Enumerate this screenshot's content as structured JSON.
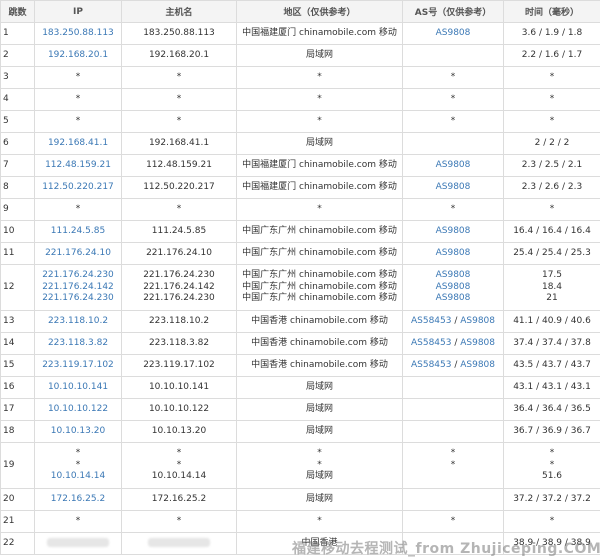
{
  "headers": {
    "hop": "跳数",
    "ip": "IP",
    "host": "主机名",
    "region": "地区（仅供参考）",
    "as": "AS号（仅供参考）",
    "time": "时间（毫秒）"
  },
  "rows": [
    {
      "hop": "1",
      "ip": [
        "183.250.88.113"
      ],
      "host": [
        "183.250.88.113"
      ],
      "region": [
        "中国福建厦门 chinamobile.com 移动"
      ],
      "as": [
        [
          "AS9808"
        ]
      ],
      "time": [
        "3.6 / 1.9 / 1.8"
      ]
    },
    {
      "hop": "2",
      "ip": [
        "192.168.20.1"
      ],
      "host": [
        "192.168.20.1"
      ],
      "region": [
        "局域网"
      ],
      "as": [
        []
      ],
      "time": [
        "2.2 / 1.6 / 1.7"
      ]
    },
    {
      "hop": "3",
      "ip": [
        "*"
      ],
      "host": [
        "*"
      ],
      "region": [
        "*"
      ],
      "as": [
        [
          "*"
        ]
      ],
      "time": [
        "*"
      ]
    },
    {
      "hop": "4",
      "ip": [
        "*"
      ],
      "host": [
        "*"
      ],
      "region": [
        "*"
      ],
      "as": [
        [
          "*"
        ]
      ],
      "time": [
        "*"
      ]
    },
    {
      "hop": "5",
      "ip": [
        "*"
      ],
      "host": [
        "*"
      ],
      "region": [
        "*"
      ],
      "as": [
        [
          "*"
        ]
      ],
      "time": [
        "*"
      ]
    },
    {
      "hop": "6",
      "ip": [
        "192.168.41.1"
      ],
      "host": [
        "192.168.41.1"
      ],
      "region": [
        "局域网"
      ],
      "as": [
        []
      ],
      "time": [
        "2 / 2 / 2"
      ]
    },
    {
      "hop": "7",
      "ip": [
        "112.48.159.21"
      ],
      "host": [
        "112.48.159.21"
      ],
      "region": [
        "中国福建厦门 chinamobile.com 移动"
      ],
      "as": [
        [
          "AS9808"
        ]
      ],
      "time": [
        "2.3 / 2.5 / 2.1"
      ]
    },
    {
      "hop": "8",
      "ip": [
        "112.50.220.217"
      ],
      "host": [
        "112.50.220.217"
      ],
      "region": [
        "中国福建厦门 chinamobile.com 移动"
      ],
      "as": [
        [
          "AS9808"
        ]
      ],
      "time": [
        "2.3 / 2.6 / 2.3"
      ]
    },
    {
      "hop": "9",
      "ip": [
        "*"
      ],
      "host": [
        "*"
      ],
      "region": [
        "*"
      ],
      "as": [
        [
          "*"
        ]
      ],
      "time": [
        "*"
      ]
    },
    {
      "hop": "10",
      "ip": [
        "111.24.5.85"
      ],
      "host": [
        "111.24.5.85"
      ],
      "region": [
        "中国广东广州 chinamobile.com 移动"
      ],
      "as": [
        [
          "AS9808"
        ]
      ],
      "time": [
        "16.4 / 16.4 / 16.4"
      ]
    },
    {
      "hop": "11",
      "ip": [
        "221.176.24.10"
      ],
      "host": [
        "221.176.24.10"
      ],
      "region": [
        "中国广东广州 chinamobile.com 移动"
      ],
      "as": [
        [
          "AS9808"
        ]
      ],
      "time": [
        "25.4 / 25.4 / 25.3"
      ]
    },
    {
      "hop": "12",
      "ip": [
        "221.176.24.230",
        "221.176.24.142",
        "221.176.24.230"
      ],
      "host": [
        "221.176.24.230",
        "221.176.24.142",
        "221.176.24.230"
      ],
      "region": [
        "中国广东广州 chinamobile.com 移动",
        "中国广东广州 chinamobile.com 移动",
        "中国广东广州 chinamobile.com 移动"
      ],
      "as": [
        [
          "AS9808"
        ],
        [
          "AS9808"
        ],
        [
          "AS9808"
        ]
      ],
      "time": [
        "17.5",
        "18.4",
        "21"
      ]
    },
    {
      "hop": "13",
      "ip": [
        "223.118.10.2"
      ],
      "host": [
        "223.118.10.2"
      ],
      "region": [
        "中国香港 chinamobile.com 移动"
      ],
      "as": [
        [
          "AS58453",
          "AS9808"
        ]
      ],
      "time": [
        "41.1 / 40.9 / 40.6"
      ]
    },
    {
      "hop": "14",
      "ip": [
        "223.118.3.82"
      ],
      "host": [
        "223.118.3.82"
      ],
      "region": [
        "中国香港 chinamobile.com 移动"
      ],
      "as": [
        [
          "AS58453",
          "AS9808"
        ]
      ],
      "time": [
        "37.4 / 37.4 / 37.8"
      ]
    },
    {
      "hop": "15",
      "ip": [
        "223.119.17.102"
      ],
      "host": [
        "223.119.17.102"
      ],
      "region": [
        "中国香港 chinamobile.com 移动"
      ],
      "as": [
        [
          "AS58453",
          "AS9808"
        ]
      ],
      "time": [
        "43.5 / 43.7 / 43.7"
      ]
    },
    {
      "hop": "16",
      "ip": [
        "10.10.10.141"
      ],
      "host": [
        "10.10.10.141"
      ],
      "region": [
        "局域网"
      ],
      "as": [
        []
      ],
      "time": [
        "43.1 / 43.1 / 43.1"
      ]
    },
    {
      "hop": "17",
      "ip": [
        "10.10.10.122"
      ],
      "host": [
        "10.10.10.122"
      ],
      "region": [
        "局域网"
      ],
      "as": [
        []
      ],
      "time": [
        "36.4 / 36.4 / 36.5"
      ]
    },
    {
      "hop": "18",
      "ip": [
        "10.10.13.20"
      ],
      "host": [
        "10.10.13.20"
      ],
      "region": [
        "局域网"
      ],
      "as": [
        []
      ],
      "time": [
        "36.7 / 36.9 / 36.7"
      ]
    },
    {
      "hop": "19",
      "ip": [
        "*",
        "*",
        "10.10.14.14"
      ],
      "host": [
        "*",
        "*",
        "10.10.14.14"
      ],
      "region": [
        "*",
        "*",
        "局域网"
      ],
      "as": [
        [
          "*"
        ],
        [
          "*"
        ],
        []
      ],
      "time": [
        "*",
        "*",
        "51.6"
      ]
    },
    {
      "hop": "20",
      "ip": [
        "172.16.25.2"
      ],
      "host": [
        "172.16.25.2"
      ],
      "region": [
        "局域网"
      ],
      "as": [
        []
      ],
      "time": [
        "37.2 / 37.2 / 37.2"
      ]
    },
    {
      "hop": "21",
      "ip": [
        "*"
      ],
      "host": [
        "*"
      ],
      "region": [
        "*"
      ],
      "as": [
        [
          "*"
        ]
      ],
      "time": [
        "*"
      ]
    },
    {
      "hop": "22",
      "ip": [
        null
      ],
      "host": [
        null
      ],
      "region": [
        "中国香港"
      ],
      "as": [
        []
      ],
      "time": [
        "38.9 / 38.9 / 38.9"
      ]
    }
  ],
  "watermark": "福建移动去程测试_from Zhujiceping.COM",
  "colors": {
    "link": "#3b78b5",
    "border": "#dcdcdc",
    "header_bg": "#f4f4f4",
    "text": "#333333"
  }
}
